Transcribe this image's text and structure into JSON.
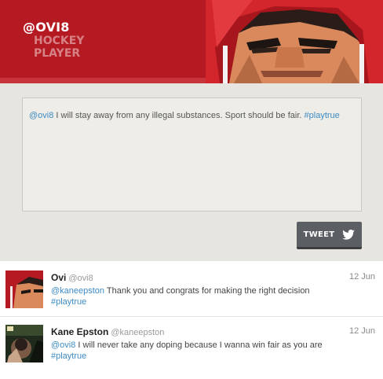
{
  "header": {
    "handle": "@OVI8",
    "title_line1": "HOCKEY",
    "title_line2": "PLAYER",
    "brand_color": "#b51a22"
  },
  "compose": {
    "mention": "@ovi8",
    "text": " I will stay away from any illegal substances. Sport should be fair. ",
    "hashtag": "#playtrue"
  },
  "tweet_button": {
    "label": "TWEET",
    "icon": "twitter-bird-icon"
  },
  "feed": [
    {
      "name": "Ovi",
      "handle": "@ovi8",
      "date": "12 Jun",
      "mention": "@kaneepston",
      "text": " Thank you and congrats for making the right decision ",
      "hashtag": "#playtrue"
    },
    {
      "name": "Kane Epston",
      "handle": "@kaneepston",
      "date": "12 Jun",
      "mention": "@ovi8",
      "text": " I will never take any doping because I wanna win fair as you are ",
      "hashtag": "#playtrue"
    }
  ],
  "colors": {
    "link": "#3d8bc4",
    "button": "#5b5e62",
    "background": "#e6e5df"
  }
}
